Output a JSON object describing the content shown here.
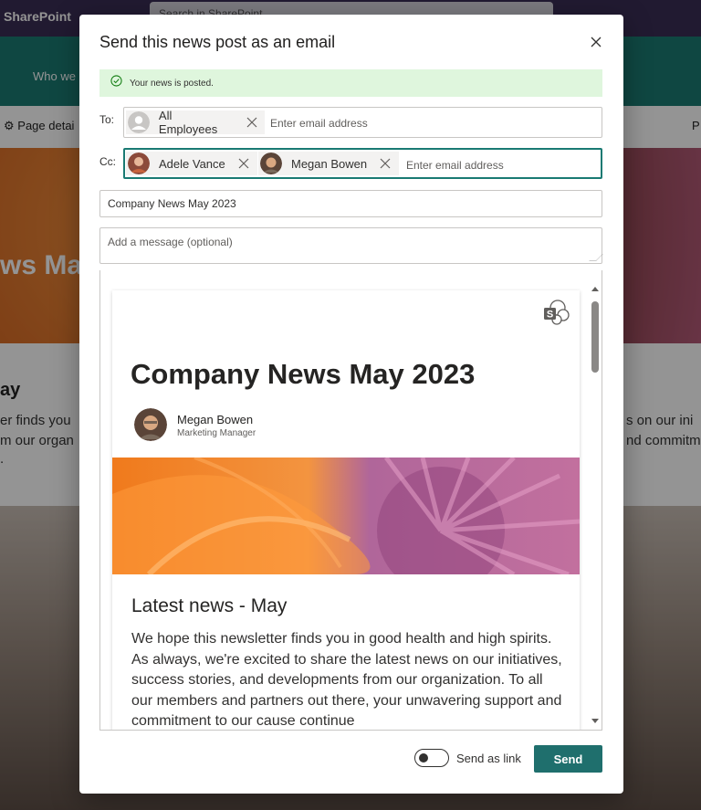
{
  "background": {
    "brand": "SharePoint",
    "search_placeholder": "Search in SharePoint",
    "nav_item": "Who we",
    "page_details": "Page detai",
    "right_cmd": "P",
    "hero_title": "ws May",
    "section_heading": "ay",
    "text_line1": "er finds you",
    "text_line2": "m our organ",
    "text_line3": ".",
    "right_line1": "s on our ini",
    "right_line2": "nd commitm"
  },
  "dialog": {
    "title": "Send this news post as an email",
    "banner": "Your news is posted.",
    "to": {
      "label": "To:",
      "recipients": [
        {
          "name": "All Employees"
        }
      ],
      "placeholder": "Enter email address"
    },
    "cc": {
      "label": "Cc:",
      "recipients": [
        {
          "name": "Adele Vance"
        },
        {
          "name": "Megan Bowen"
        }
      ],
      "placeholder": "Enter email address"
    },
    "subject": "Company News May 2023",
    "message_placeholder": "Add a message (optional)",
    "preview": {
      "title": "Company News May 2023",
      "author_name": "Megan Bowen",
      "author_role": "Marketing Manager",
      "subheading": "Latest news - May",
      "paragraph": "We hope this newsletter finds you in good health and high spirits. As always, we're excited to share the latest news on our initiatives, success stories, and developments from our organization. To all our members and partners out there, your unwavering support and commitment to our cause continue"
    },
    "send_as_link_label": "Send as link",
    "send_button": "Send"
  },
  "colors": {
    "accent": "#1f6f6d",
    "banner_success": "#dff6dd",
    "suite_bar": "#3a2e55",
    "site_header": "#1a7a73"
  }
}
